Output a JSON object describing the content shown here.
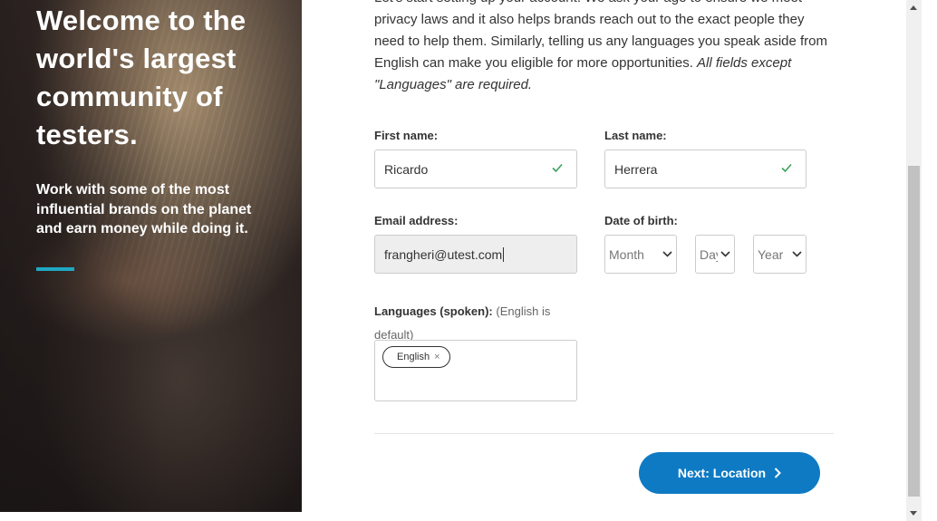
{
  "hero": {
    "title": "Welcome to the\nworld's largest\ncommunity of\ntesters.",
    "subtitle": "Work with some of the most\ninfluential brands on the planet\nand earn money while doing it.",
    "accent_color": "#1fa8c4"
  },
  "intro": {
    "text": "Let's start setting up your account. We ask your age to ensure we meet privacy laws and it also helps brands reach out to the exact people they need to help them. Similarly, telling us any languages you speak aside from English can make you eligible for more opportunities. ",
    "emphasis": "All fields except \"Languages\" are required."
  },
  "form": {
    "first_name": {
      "label": "First name:",
      "value": "Ricardo",
      "valid_icon": "check-icon"
    },
    "last_name": {
      "label": "Last name:",
      "value": "Herrera",
      "valid_icon": "check-icon"
    },
    "email": {
      "label": "Email address:",
      "value": "frangheri@utest.com"
    },
    "dob": {
      "label": "Date of birth:",
      "month": "Month",
      "day": "Day",
      "year": "Year"
    },
    "languages": {
      "label": "Languages (spoken):",
      "note": "(English is default)",
      "selected": [
        {
          "name": "English",
          "remove": "×"
        }
      ]
    }
  },
  "actions": {
    "next_label": "Next: Location",
    "next_icon": "chevron-right-icon",
    "button_color": "#0e7ac4"
  },
  "colors": {
    "valid_check": "#3aa35a",
    "border": "#cccccc"
  }
}
